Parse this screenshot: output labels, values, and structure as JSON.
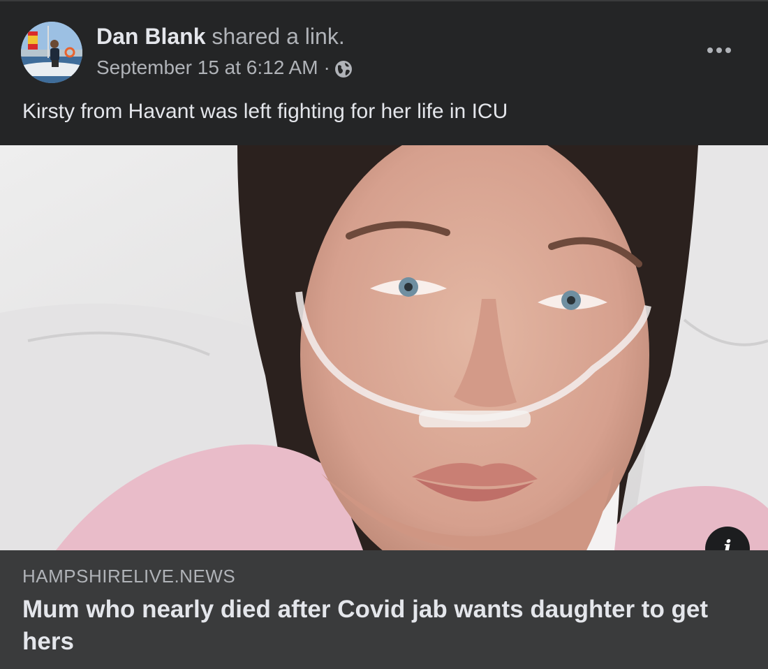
{
  "post": {
    "author": "Dan Blank",
    "action": "shared a link.",
    "timestamp": "September 15 at 6:12 AM",
    "separator": "·",
    "audience_icon": "globe-icon",
    "more_icon": "more-options-icon",
    "text": "Kirsty from Havant was left fighting for her life in ICU"
  },
  "link": {
    "domain": "HAMPSHIRELIVE.NEWS",
    "title": "Mum who nearly died after Covid jab wants daughter to get hers",
    "info_label": "i"
  },
  "colors": {
    "background": "#242526",
    "footer": "#3a3b3c",
    "primary_text": "#e4e6eb",
    "secondary_text": "#b0b3b8"
  }
}
